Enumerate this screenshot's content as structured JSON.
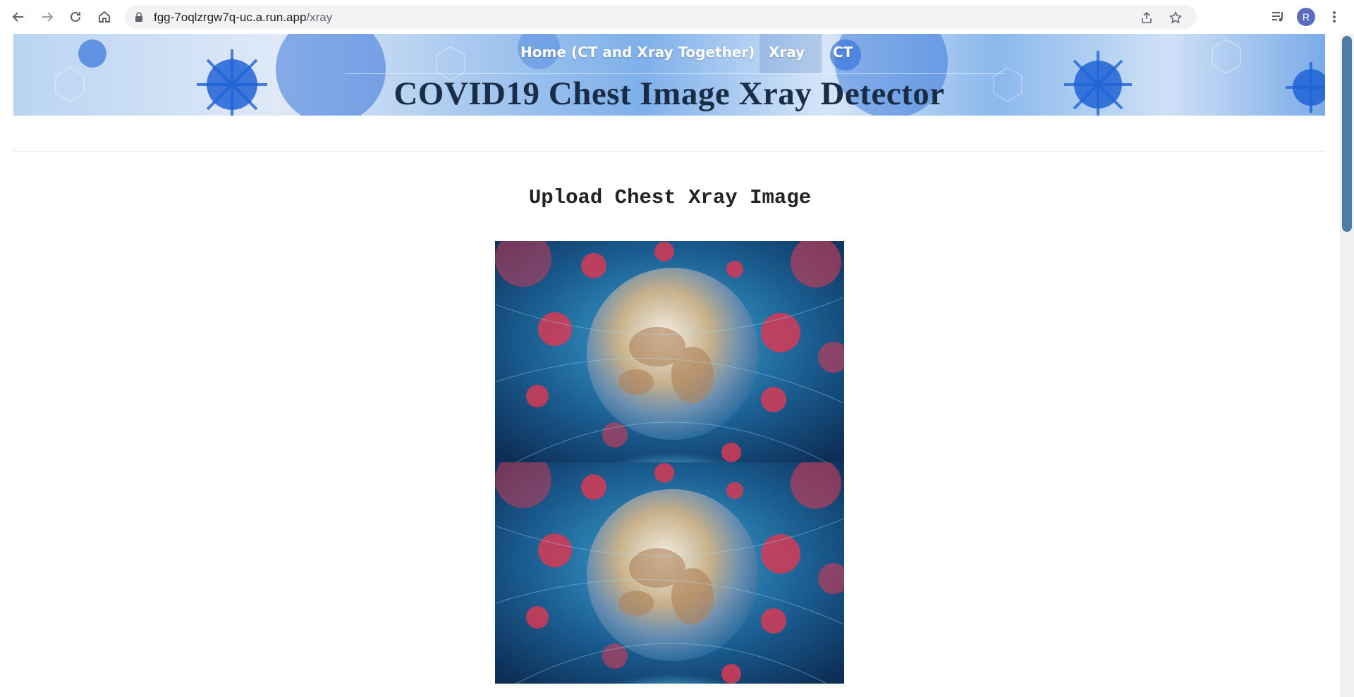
{
  "browser": {
    "url_host": "fgg-7oqlzrgw7q-uc.a.run.app",
    "url_path": "/xray",
    "avatar_letter": "R",
    "icons": [
      "back-icon",
      "forward-icon",
      "reload-icon",
      "home-icon",
      "lock-icon",
      "share-icon",
      "star-icon",
      "media-queue-icon",
      "kebab-menu-icon"
    ]
  },
  "nav": {
    "items": [
      {
        "label": "Home (CT and Xray Together)"
      },
      {
        "label": "Xray"
      },
      {
        "label": "CT"
      }
    ]
  },
  "banner": {
    "title": "COVID19 Chest Image Xray Detector"
  },
  "main": {
    "heading": "Upload Chest Xray Image",
    "images": [
      "earth-virus-image",
      "earth-virus-image"
    ]
  },
  "colors": {
    "title": "#1a2d46",
    "scroll_thumb": "#4c7da6",
    "banner_blue": "#7fb0ea"
  }
}
